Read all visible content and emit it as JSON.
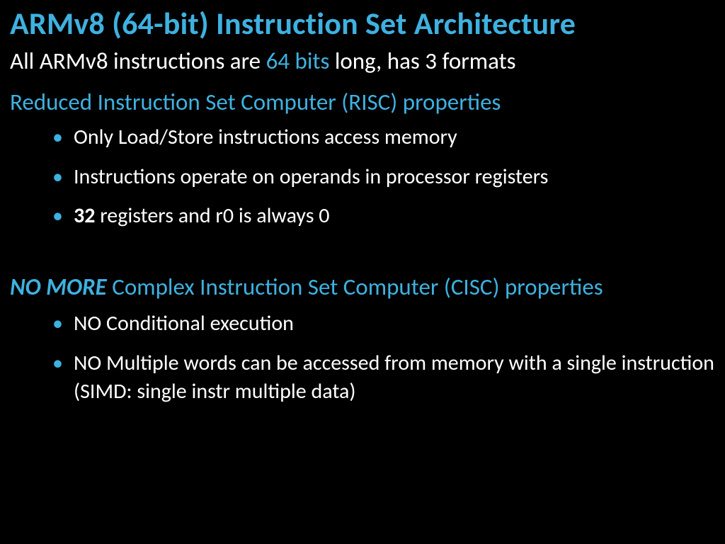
{
  "title": "ARMv8 (64-bit) Instruction Set Architecture",
  "line1_a": "All ARMv8 instructions are ",
  "line1_b": "64 bits",
  "line1_c": " long, has 3 formats",
  "subhead1": "Reduced Instruction Set Computer (RISC) properties",
  "risc": {
    "b1": "Only Load/Store instructions access memory",
    "b2": "Instructions operate on operands in processor registers",
    "b3_a": "32",
    "b3_b": " registers and r0 is always 0"
  },
  "subhead2_a": "NO MORE",
  "subhead2_b": " Complex Instruction Set Computer (CISC) properties",
  "cisc": {
    "b1": "NO Conditional execution",
    "b2": "NO Multiple words can be accessed from memory with a single instruction (SIMD: single instr multiple data)"
  }
}
